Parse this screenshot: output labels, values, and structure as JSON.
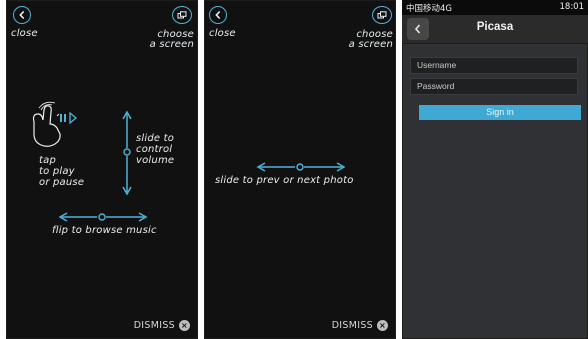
{
  "screens": [
    {
      "close_label": "close",
      "choose_label_line1": "choose",
      "choose_label_line2": "a screen",
      "tap_line1": "tap",
      "tap_line2": "to play",
      "tap_line3": "or pause",
      "slide_line1": "slide to",
      "slide_line2": "control",
      "slide_line3": "volume",
      "flip_text": "flip to browse music",
      "dismiss_label": "DISMISS"
    },
    {
      "close_label": "close",
      "choose_label_line1": "choose",
      "choose_label_line2": "a screen",
      "slide_text": "slide to prev or next photo",
      "dismiss_label": "DISMISS"
    }
  ],
  "picasa": {
    "status_left": "中国移动4G",
    "status_right": "18:01",
    "title": "Picasa",
    "username_placeholder": "Username",
    "password_placeholder": "Password",
    "signin_label": "Sign in"
  },
  "colors": {
    "accent": "#4fb3d8",
    "signin": "#3fa9d4",
    "screen_bg": "#111111"
  }
}
